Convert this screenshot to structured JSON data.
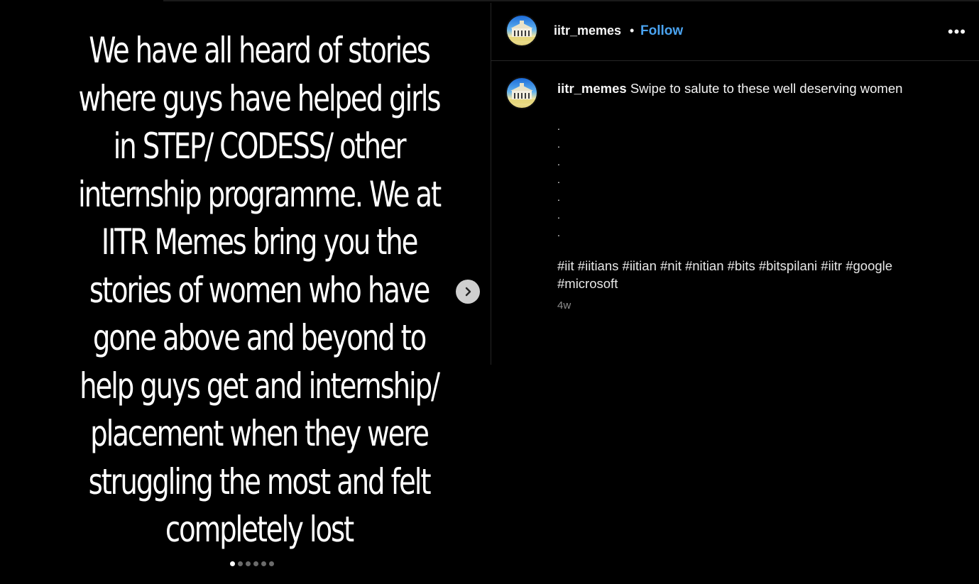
{
  "slide": {
    "text": "We have all heard of stories\nwhere guys have helped girls\nin STEP/ CODESS/ other\ninternship programme. We at\nIITR Memes bring you the\nstories of women who have\ngone above and beyond to\nhelp guys get and internship/\nplacement when they were\nstruggling the most and felt\ncompletely lost",
    "total_slides": 6,
    "current_slide": 1
  },
  "header": {
    "username": "iitr_memes",
    "separator": "•",
    "follow_label": "Follow",
    "more_label": "•••"
  },
  "caption": {
    "username": "iitr_memes",
    "text": "Swipe to salute to these well deserving women",
    "dots": ".\n.\n.\n.\n.\n.\n.",
    "hashtags": [
      "#iit",
      "#iitians",
      "#iitian",
      "#nit",
      "#nitian",
      "#bits",
      "#bitspilani",
      "#iitr",
      "#google",
      "#microsoft"
    ],
    "timestamp": "4w"
  },
  "icons": {
    "next": "chevron-right-icon",
    "avatar": "building-logo-icon"
  },
  "colors": {
    "background": "#000000",
    "text": "#f5f5f5",
    "follow": "#4aa3f0",
    "muted": "#8e8e8e",
    "border": "#262626"
  }
}
